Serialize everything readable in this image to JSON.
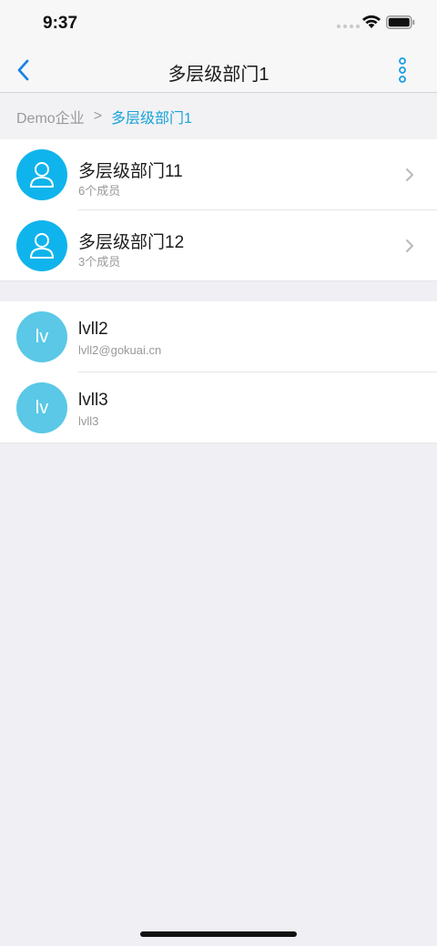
{
  "status": {
    "time": "9:37"
  },
  "nav": {
    "title": "多层级部门1"
  },
  "breadcrumb": {
    "root": "Demo企业",
    "separator": ">",
    "current": "多层级部门1"
  },
  "departments": [
    {
      "name": "多层级部门11",
      "members": "6个成员"
    },
    {
      "name": "多层级部门12",
      "members": "3个成员"
    }
  ],
  "members": [
    {
      "initials": "lv",
      "name": "lvll2",
      "detail": "lvll2@gokuai.cn"
    },
    {
      "initials": "lv",
      "name": "lvll3",
      "detail": "lvll3"
    }
  ],
  "colors": {
    "accent": "#1aa3d9",
    "dept_avatar": "#10b4ec",
    "user_avatar": "#5ac8e6",
    "back_arrow": "#1a82e6"
  }
}
